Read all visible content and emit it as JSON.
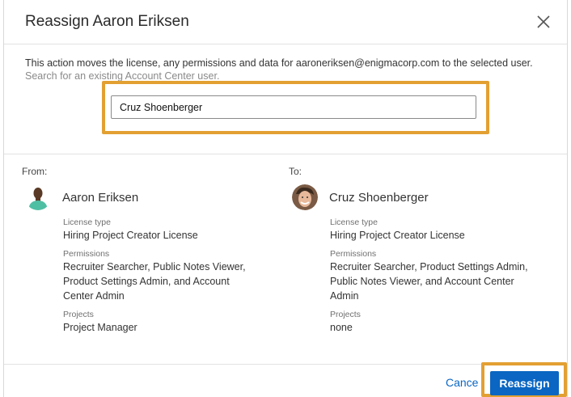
{
  "dialog": {
    "title": "Reassign Aaron Eriksen",
    "description": "This action moves the license, any permissions and data for aaroneriksen@enigmacorp.com to the selected user.",
    "hint": "Search for an existing Account Center user.",
    "search": {
      "value": "Cruz Shoenberger"
    }
  },
  "from": {
    "label": "From:",
    "name": "Aaron Eriksen",
    "license_label": "License type",
    "license_value": "Hiring Project Creator License",
    "permissions_label": "Permissions",
    "permissions_value": "Recruiter Searcher, Public Notes Viewer, Product Settings Admin, and Account Center Admin",
    "projects_label": "Projects",
    "projects_value": "Project Manager"
  },
  "to": {
    "label": "To:",
    "name": "Cruz Shoenberger",
    "license_label": "License type",
    "license_value": "Hiring Project Creator License",
    "permissions_label": "Permissions",
    "permissions_value": "Recruiter Searcher, Product Settings Admin, Public Notes Viewer, and Account Center Admin",
    "projects_label": "Projects",
    "projects_value": "none"
  },
  "footer": {
    "cancel_label": "Cancel",
    "reassign_label": "Reassign"
  },
  "colors": {
    "accent": "#0a66c2",
    "highlight": "#e3a032"
  },
  "icons": {
    "close": "close-icon"
  }
}
